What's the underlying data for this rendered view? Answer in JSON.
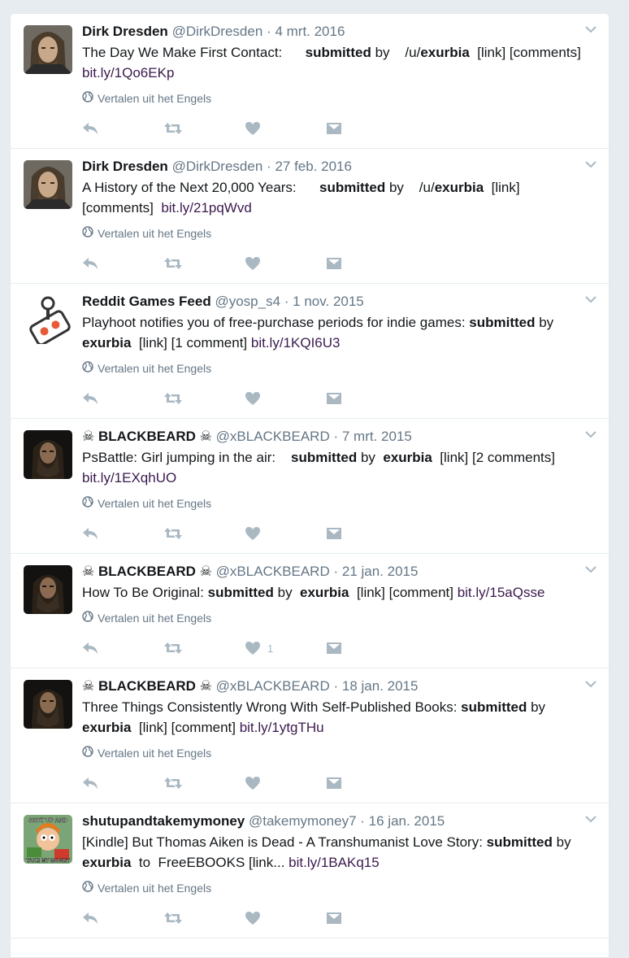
{
  "translate_label": "Vertalen uit het Engels",
  "tweets": [
    {
      "name": "Dirk Dresden",
      "handle": "@DirkDresden",
      "sep": "·",
      "date": "4 mrt. 2016",
      "avatar": "longhair-man",
      "segments": [
        {
          "t": "The Day We Make First Contact:      ",
          "s": "text"
        },
        {
          "t": "submitted",
          "s": "bold"
        },
        {
          "t": " by    /u/",
          "s": "text"
        },
        {
          "t": "exurbia",
          "s": "bold"
        },
        {
          "t": "  [link] [comments]  ",
          "s": "text"
        },
        {
          "t": "bit.ly/1Qo6EKp",
          "s": "link"
        }
      ],
      "like_count": ""
    },
    {
      "name": "Dirk Dresden",
      "handle": "@DirkDresden",
      "sep": "·",
      "date": "27 feb. 2016",
      "avatar": "longhair-man",
      "segments": [
        {
          "t": "A History of the Next 20,000 Years:      ",
          "s": "text"
        },
        {
          "t": "submitted",
          "s": "bold"
        },
        {
          "t": " by    /u/",
          "s": "text"
        },
        {
          "t": "exurbia",
          "s": "bold"
        },
        {
          "t": "  [link] [comments]  ",
          "s": "text"
        },
        {
          "t": "bit.ly/21pqWvd",
          "s": "link"
        }
      ],
      "like_count": ""
    },
    {
      "name": "Reddit Games Feed",
      "handle": "@yosp_s4",
      "sep": "·",
      "date": "1 nov. 2015",
      "avatar": "joystick-logo",
      "segments": [
        {
          "t": "Playhoot notifies you of free-purchase periods for indie games: ",
          "s": "text"
        },
        {
          "t": "submitted",
          "s": "bold"
        },
        {
          "t": " by ",
          "s": "text"
        },
        {
          "t": "exurbia",
          "s": "bold"
        },
        {
          "t": "  [link] [1 comment] ",
          "s": "text"
        },
        {
          "t": "bit.ly/1KQI6U3",
          "s": "link"
        }
      ],
      "like_count": ""
    },
    {
      "name": "BLACKBEARD",
      "handle": "@xBLACKBEARD",
      "sep": "·",
      "date": "7 mrt. 2015",
      "avatar": "bearded-man",
      "skull": "☠",
      "segments": [
        {
          "t": "PsBattle: Girl jumping in the air:    ",
          "s": "text"
        },
        {
          "t": "submitted",
          "s": "bold"
        },
        {
          "t": " by  ",
          "s": "text"
        },
        {
          "t": "exurbia",
          "s": "bold"
        },
        {
          "t": "  [link] [2 comments] ",
          "s": "text"
        },
        {
          "t": "bit.ly/1EXqhUO",
          "s": "link"
        }
      ],
      "like_count": ""
    },
    {
      "name": "BLACKBEARD",
      "handle": "@xBLACKBEARD",
      "sep": "·",
      "date": "21 jan. 2015",
      "avatar": "bearded-man",
      "skull": "☠",
      "segments": [
        {
          "t": "How To Be Original: ",
          "s": "text"
        },
        {
          "t": "submitted",
          "s": "bold"
        },
        {
          "t": " by  ",
          "s": "text"
        },
        {
          "t": "exurbia",
          "s": "bold"
        },
        {
          "t": "  [link] [comment] ",
          "s": "text"
        },
        {
          "t": "bit.ly/15aQsse",
          "s": "link"
        }
      ],
      "like_count": "1"
    },
    {
      "name": "BLACKBEARD",
      "handle": "@xBLACKBEARD",
      "sep": "·",
      "date": "18 jan. 2015",
      "avatar": "bearded-man",
      "skull": "☠",
      "segments": [
        {
          "t": "Three Things Consistently Wrong With Self-Published Books: ",
          "s": "text"
        },
        {
          "t": "submitted",
          "s": "bold"
        },
        {
          "t": " by ",
          "s": "text"
        },
        {
          "t": "exurbia",
          "s": "bold"
        },
        {
          "t": "  [link] [comment] ",
          "s": "text"
        },
        {
          "t": "bit.ly/1ytgTHu",
          "s": "link"
        }
      ],
      "like_count": ""
    },
    {
      "name": "shutupandtakemymoney",
      "handle": "@takemymoney7",
      "sep": "·",
      "date": "16 jan. 2015",
      "avatar": "meme-fry",
      "avatar_text_top": "SHUT UP AND",
      "avatar_text_bottom": "TAKE MY MONEY",
      "segments": [
        {
          "t": "[Kindle] But Thomas Aiken is Dead - A Transhumanist Love Story: ",
          "s": "text"
        },
        {
          "t": "submitted",
          "s": "bold"
        },
        {
          "t": " by  ",
          "s": "text"
        },
        {
          "t": "exurbia",
          "s": "bold"
        },
        {
          "t": "  to  FreeEBOOKS [link... ",
          "s": "text"
        },
        {
          "t": "bit.ly/1BAKq15",
          "s": "link"
        }
      ],
      "like_count": ""
    }
  ]
}
